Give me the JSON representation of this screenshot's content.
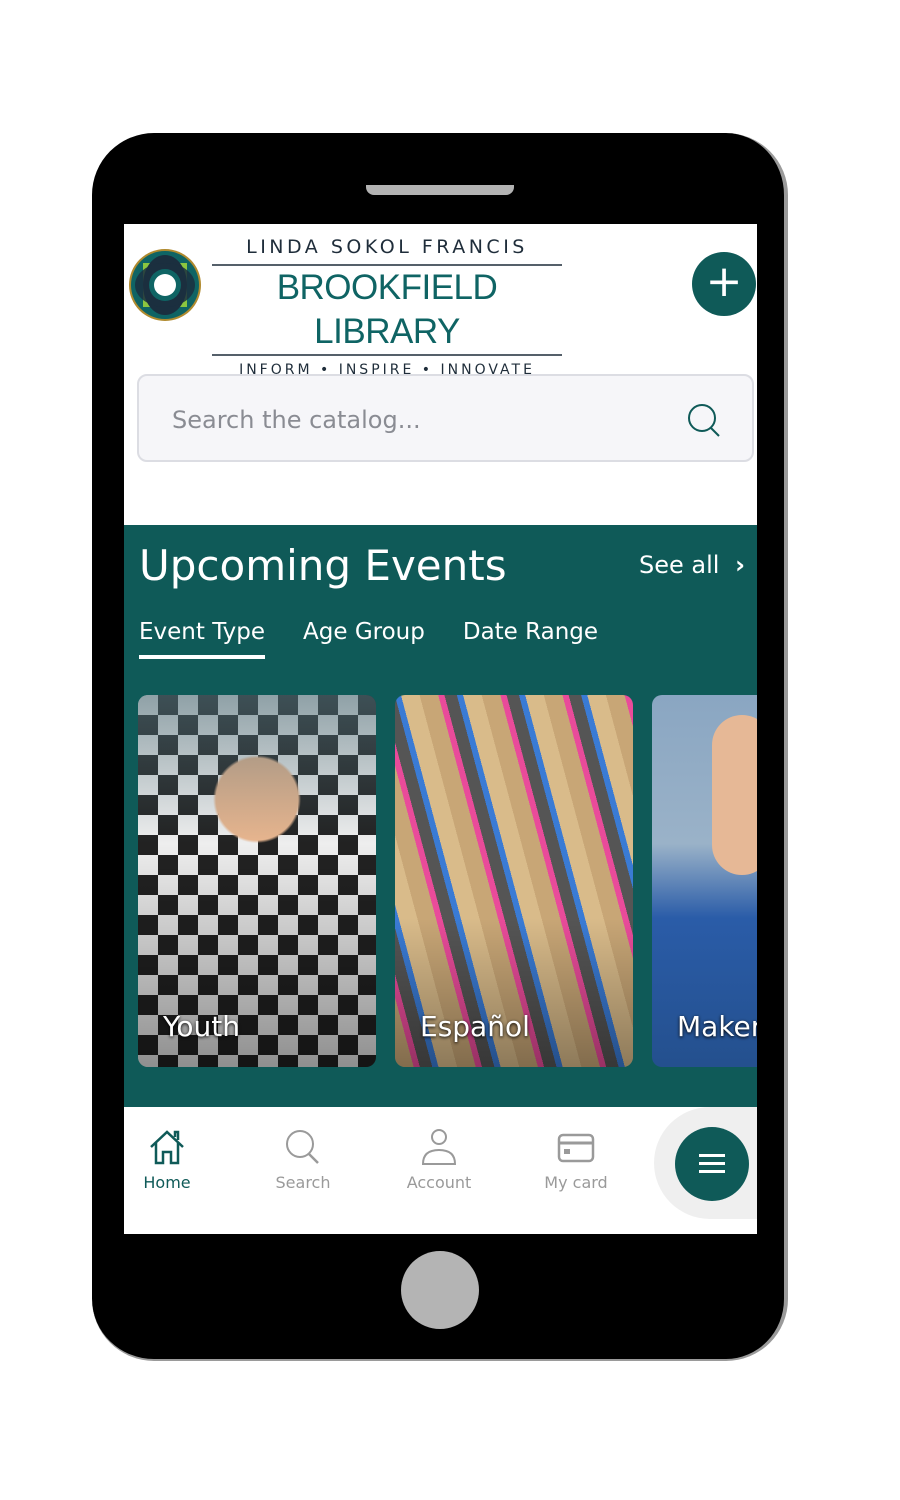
{
  "brand": {
    "line1": "LINDA SOKOL FRANCIS",
    "line2": "BROOKFIELD LIBRARY",
    "line3": "INFORM • INSPIRE • INNOVATE"
  },
  "search": {
    "placeholder": "Search the catalog..."
  },
  "events": {
    "title": "Upcoming Events",
    "see_all": "See all",
    "tabs": [
      "Event Type",
      "Age Group",
      "Date Range"
    ],
    "active_tab": "Event Type",
    "cards": [
      {
        "label": "Youth"
      },
      {
        "label": "Español"
      },
      {
        "label": "Maker"
      }
    ]
  },
  "nav": {
    "items": [
      {
        "label": "Home",
        "icon": "home-icon"
      },
      {
        "label": "Search",
        "icon": "search-icon"
      },
      {
        "label": "Account",
        "icon": "account-icon"
      },
      {
        "label": "My card",
        "icon": "card-icon"
      }
    ],
    "active": "Home"
  },
  "colors": {
    "primary": "#0f5a58",
    "inactive": "#9a9a9a"
  }
}
